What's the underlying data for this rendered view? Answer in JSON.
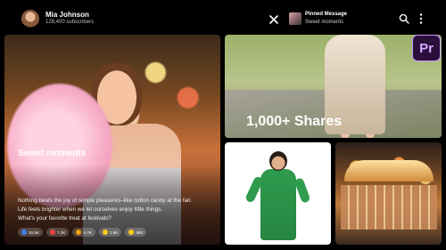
{
  "header": {
    "channel_name": "Mia Johnson",
    "subscribers": "128,400 subscribers",
    "pinned_title": "Pinned Message",
    "pinned_subtitle": "Sweet moments"
  },
  "post": {
    "title": "Sweet moments",
    "lines": [
      "Nothing beats the joy of simple pleasures–like cotton candy at the fair.",
      "Life feels brighter when we let ourselves enjoy little things.",
      "What's your favorite treat at festivals?"
    ],
    "reactions": [
      {
        "icon": "thumbs-up-icon",
        "count": "10.5K",
        "color": "#3b82f6"
      },
      {
        "icon": "heart-icon",
        "count": "7.2K",
        "color": "#ef4444"
      },
      {
        "icon": "fire-icon",
        "count": "4.7K",
        "color": "#f59e0b"
      },
      {
        "icon": "laugh-icon",
        "count": "1.9K",
        "color": "#facc15"
      },
      {
        "icon": "cool-icon",
        "count": "890",
        "color": "#facc15"
      }
    ]
  },
  "shares_text": "1,000+ Shares",
  "badge": {
    "label": "Pr",
    "color": "#d6a8ff"
  }
}
